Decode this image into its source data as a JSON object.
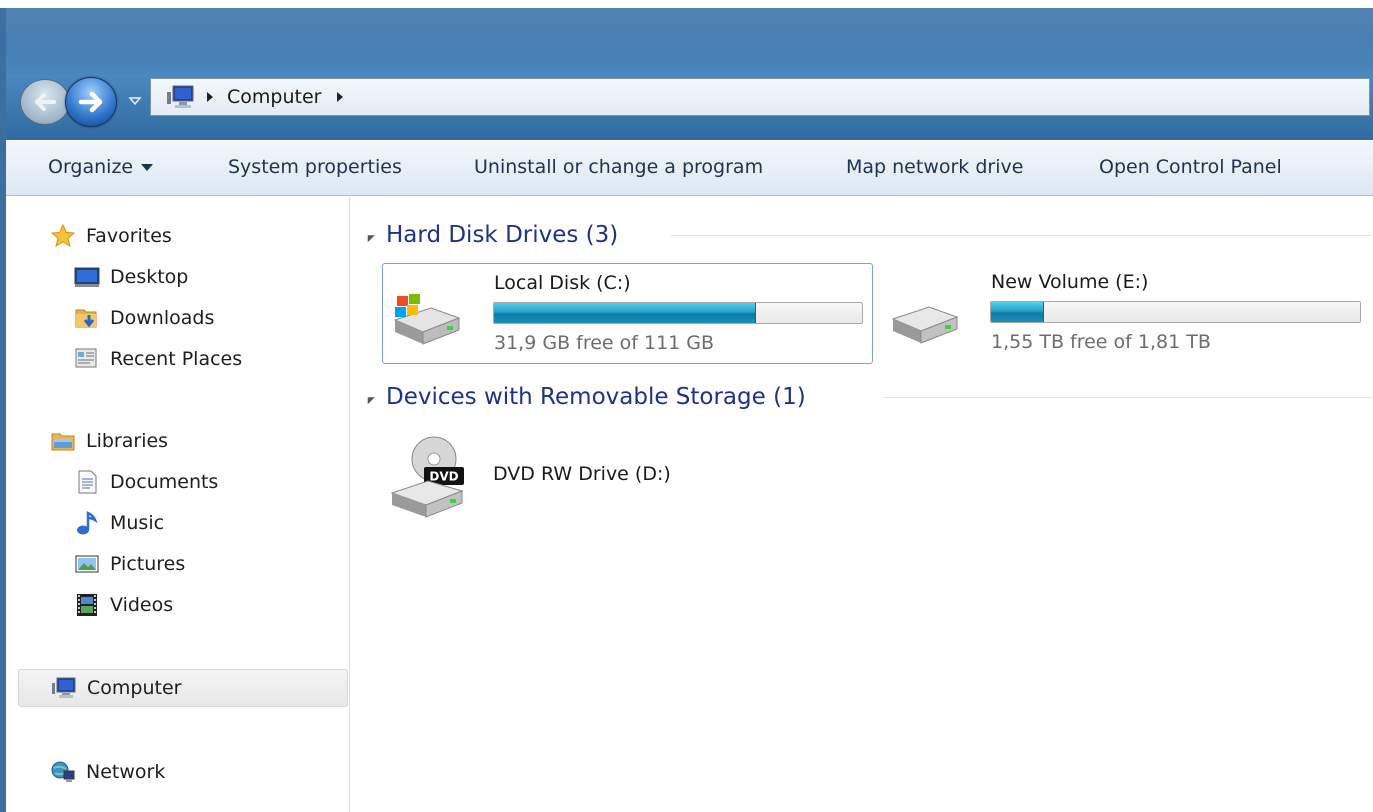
{
  "window": {
    "bg_accent": "#3c78ae"
  },
  "nav": {
    "back_icon": "arrow-left-icon",
    "forward_icon": "arrow-right-icon",
    "history_icon": "chevron-down-icon"
  },
  "address": {
    "icon": "computer-icon",
    "path": "Computer",
    "separator_icon": "chevron-right-icon"
  },
  "toolbar": {
    "organize": "Organize",
    "system_properties": "System properties",
    "uninstall": "Uninstall or change a program",
    "map_drive": "Map network drive",
    "control_panel": "Open Control Panel"
  },
  "sidebar": {
    "favorites": {
      "label": "Favorites",
      "icon": "star-icon"
    },
    "desktop": {
      "label": "Desktop",
      "icon": "desktop-icon"
    },
    "downloads": {
      "label": "Downloads",
      "icon": "downloads-folder-icon"
    },
    "recent": {
      "label": "Recent Places",
      "icon": "recent-places-icon"
    },
    "libraries": {
      "label": "Libraries",
      "icon": "libraries-icon"
    },
    "documents": {
      "label": "Documents",
      "icon": "document-icon"
    },
    "music": {
      "label": "Music",
      "icon": "music-note-icon"
    },
    "pictures": {
      "label": "Pictures",
      "icon": "picture-icon"
    },
    "videos": {
      "label": "Videos",
      "icon": "film-icon"
    },
    "computer": {
      "label": "Computer",
      "icon": "computer-icon"
    },
    "network": {
      "label": "Network",
      "icon": "network-icon"
    }
  },
  "groups": {
    "hdd": {
      "title": "Hard Disk Drives (3)"
    },
    "removable": {
      "title": "Devices with Removable Storage (1)"
    }
  },
  "drives": {
    "c": {
      "name": "Local Disk (C:)",
      "free": "31,9 GB free of 111 GB",
      "used_fraction": 0.713,
      "icon": "windows-drive-icon"
    },
    "e": {
      "name": "New Volume (E:)",
      "free": "1,55 TB free of 1,81 TB",
      "used_fraction": 0.144,
      "icon": "hard-drive-icon"
    },
    "d": {
      "name": "DVD RW Drive (D:)",
      "icon": "dvd-drive-icon",
      "icon_label": "DVD"
    }
  }
}
